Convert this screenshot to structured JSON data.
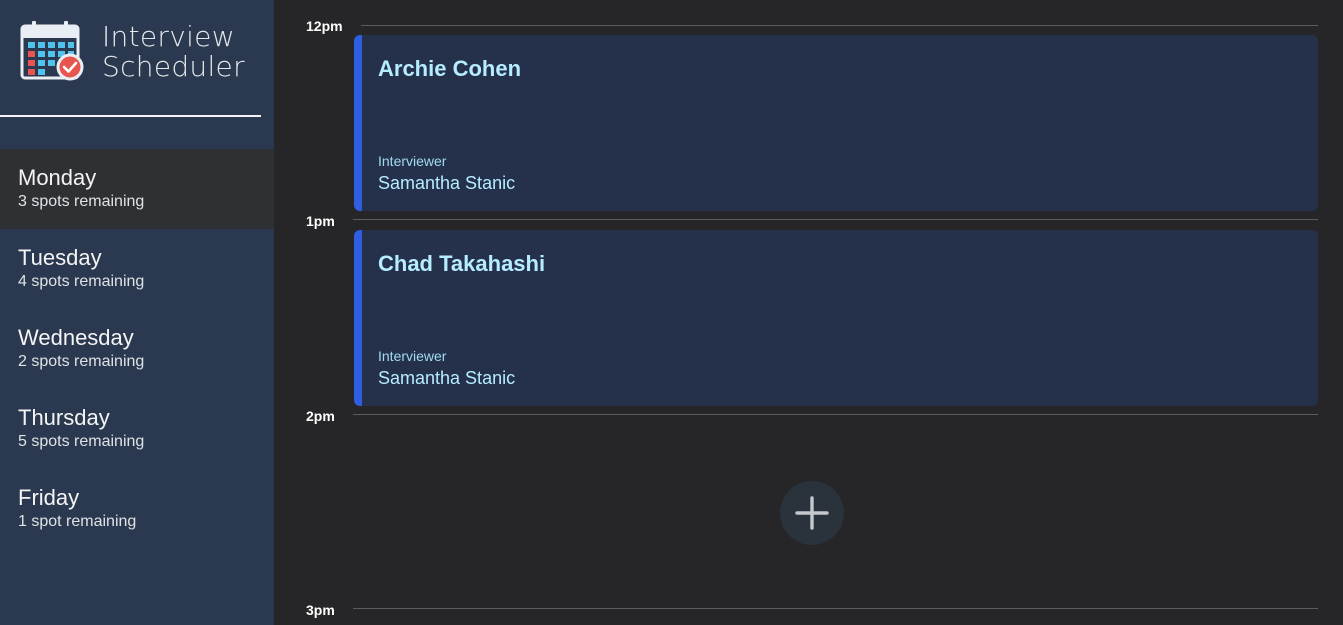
{
  "brand": {
    "title_line1": "Interview",
    "title_line2": "Scheduler",
    "logo_icon": "calendar-check-icon"
  },
  "days": [
    {
      "name": "Monday",
      "spots": "3 spots remaining",
      "selected": true
    },
    {
      "name": "Tuesday",
      "spots": "4 spots remaining",
      "selected": false
    },
    {
      "name": "Wednesday",
      "spots": "2 spots remaining",
      "selected": false
    },
    {
      "name": "Thursday",
      "spots": "5 spots remaining",
      "selected": false
    },
    {
      "name": "Friday",
      "spots": "1 spot remaining",
      "selected": false
    }
  ],
  "schedule": {
    "time_slots": [
      "12pm",
      "1pm",
      "2pm",
      "3pm"
    ],
    "appointments": [
      {
        "student": "Archie Cohen",
        "interviewer_label": "Interviewer",
        "interviewer": "Samantha Stanic"
      },
      {
        "student": "Chad Takahashi",
        "interviewer_label": "Interviewer",
        "interviewer": "Samantha Stanic"
      }
    ],
    "add_icon": "plus-icon"
  },
  "colors": {
    "sidebar_bg": "#2a394f",
    "selected_day_bg": "#2f3034",
    "main_bg": "#262628",
    "appointment_bg": "#25304a",
    "appointment_accent": "#2f5fe0",
    "appointment_text": "#b6ecff"
  }
}
